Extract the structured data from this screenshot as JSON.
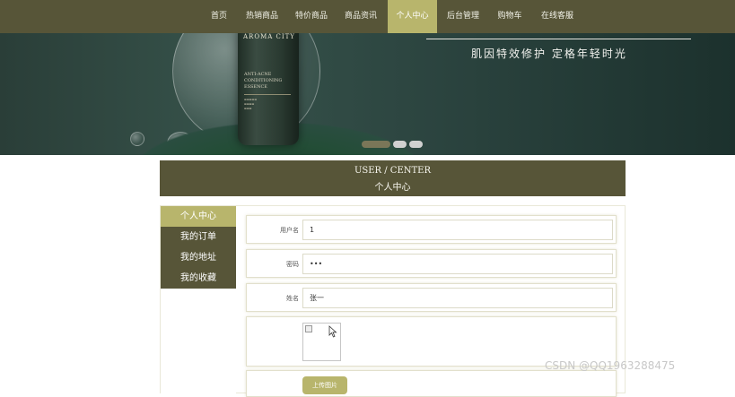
{
  "nav": {
    "items": [
      {
        "label": "首页"
      },
      {
        "label": "热销商品"
      },
      {
        "label": "特价商品"
      },
      {
        "label": "商品资讯"
      },
      {
        "label": "个人中心",
        "active": true
      },
      {
        "label": "后台管理"
      },
      {
        "label": "购物车"
      },
      {
        "label": "在线客服"
      }
    ]
  },
  "banner": {
    "brand": "AROMA CITY",
    "product_lines": [
      "ANTI-ACNE",
      "CONDITIONING",
      "ESSENCE"
    ],
    "slogan": "肌因特效修护 定格年轻时光",
    "slide_count": 3,
    "active_slide": 1
  },
  "section": {
    "title_en": "USER / CENTER",
    "title_cn": "个人中心"
  },
  "sidebar": {
    "items": [
      {
        "label": "个人中心",
        "active": true
      },
      {
        "label": "我的订单"
      },
      {
        "label": "我的地址"
      },
      {
        "label": "我的收藏"
      }
    ]
  },
  "form": {
    "username": {
      "label": "用户名",
      "value": "1"
    },
    "password": {
      "label": "密码",
      "value": "•••"
    },
    "name": {
      "label": "姓名",
      "value": "张一"
    },
    "avatar": {
      "icon": "broken-image-icon"
    },
    "upload": {
      "label": "上传图片"
    }
  },
  "watermark": "CSDN @QQ1963288475",
  "colors": {
    "primary": "#575538",
    "accent": "#b8b56c",
    "banner_bg": "#2d4641"
  }
}
